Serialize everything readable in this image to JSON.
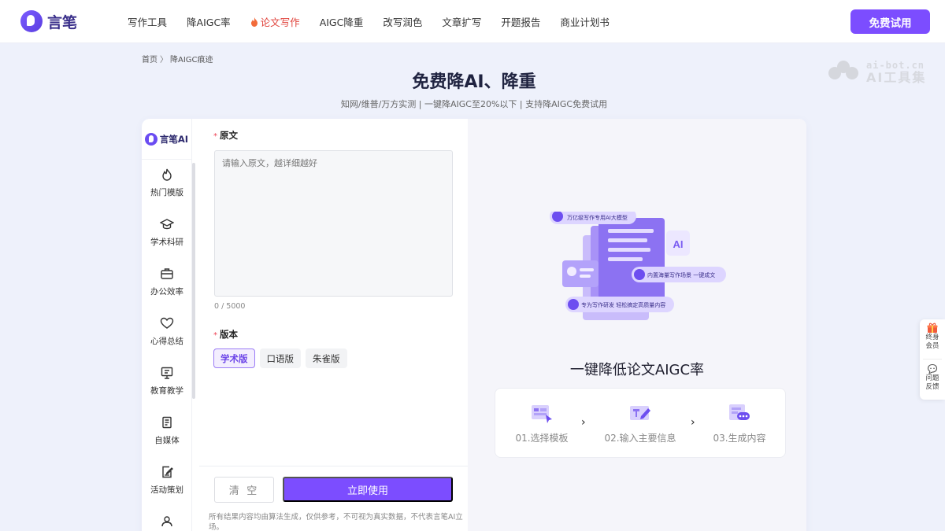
{
  "brand": {
    "name": "言笔"
  },
  "nav": {
    "items": [
      {
        "label": "写作工具"
      },
      {
        "label": "降AIGC率"
      },
      {
        "label": "论文写作",
        "active": true
      },
      {
        "label": "AIGC降重"
      },
      {
        "label": "改写润色"
      },
      {
        "label": "文章扩写"
      },
      {
        "label": "开题报告"
      },
      {
        "label": "商业计划书"
      }
    ],
    "cta_label": "免费试用"
  },
  "watermark": {
    "line1": "ai-bot.cn",
    "line2": "AI工具集"
  },
  "breadcrumb": {
    "home": "首页",
    "sep": "〉",
    "current": "降AIGC痕迹"
  },
  "header": {
    "title": "免费降AI、降重",
    "subtitle": "知网/维普/万方实测 | 一键降AIGC至20%以下 | 支持降AIGC免费试用"
  },
  "sidebar": {
    "brand": "言笔AI",
    "items": [
      {
        "label": "热门模版",
        "icon": "fire-icon"
      },
      {
        "label": "学术科研",
        "icon": "graduation-cap-icon"
      },
      {
        "label": "办公效率",
        "icon": "briefcase-icon"
      },
      {
        "label": "心得总结",
        "icon": "heart-icon"
      },
      {
        "label": "教育教学",
        "icon": "presentation-icon"
      },
      {
        "label": "自媒体",
        "icon": "note-icon"
      },
      {
        "label": "活动策划",
        "icon": "edit-document-icon"
      },
      {
        "label": "",
        "icon": "user-group-icon"
      }
    ]
  },
  "form": {
    "source_label": "原文",
    "source_placeholder": "请输入原文，越详细越好",
    "char_count": "0 / 5000",
    "version_label": "版本",
    "versions": [
      {
        "label": "学术版",
        "active": true
      },
      {
        "label": "口语版"
      },
      {
        "label": "朱雀版"
      }
    ],
    "clear_label": "清 空",
    "submit_label": "立即使用",
    "disclaimer": "所有结果内容均由算法生成，仅供参考，不可视为真实数据，不代表言笔AI立场。"
  },
  "illustration": {
    "tag1": "万亿级写作专用AI大模型",
    "tag2": "内置海量写作场景 一键成文",
    "tag3": "专为写作研发 轻松搞定高质量内容",
    "ai_badge": "AI"
  },
  "right": {
    "title": "一键降低论文AIGC率",
    "steps": [
      {
        "label": "01.选择模板",
        "icon": "template-icon"
      },
      {
        "label": "02.输入主要信息",
        "icon": "input-icon"
      },
      {
        "label": "03.生成内容",
        "icon": "generate-icon"
      }
    ],
    "arrow": "›"
  },
  "float": {
    "items": [
      {
        "label": "终身会员",
        "icon": "gift-icon"
      },
      {
        "label": "问题反馈",
        "icon": "feedback-icon"
      }
    ]
  },
  "colors": {
    "accent": "#7c4dff",
    "active_nav": "#e0423b",
    "background": "#eef1fb"
  }
}
